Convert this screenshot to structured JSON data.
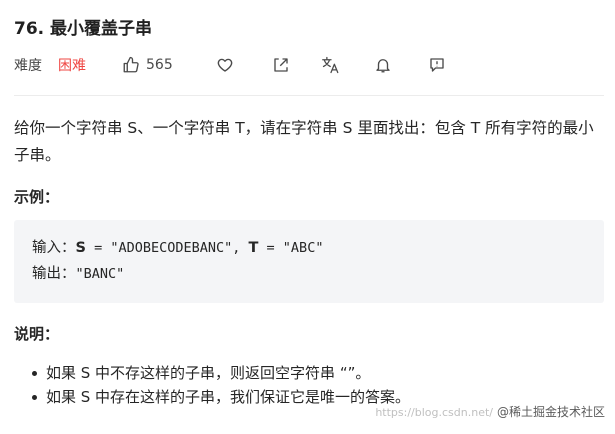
{
  "problem": {
    "title": "76. 最小覆盖子串",
    "difficulty_label": "难度",
    "difficulty_value": "困难",
    "likes": "565"
  },
  "description": "给你一个字符串 S、一个字符串 T，请在字符串 S 里面找出：包含 T 所有字符的最小子串。",
  "example": {
    "heading": "示例：",
    "input_label": "输入：",
    "s_var": "S",
    "s_value": " = \"ADOBECODEBANC\", ",
    "t_var": "T",
    "t_value": " = \"ABC\"",
    "output_label": "输出：",
    "output_value": "\"BANC\""
  },
  "notes": {
    "heading": "说明：",
    "items": [
      "如果 S 中不存这样的子串，则返回空字符串 “”。",
      "如果 S 中存在这样的子串，我们保证它是唯一的答案。"
    ]
  },
  "watermark": {
    "url": "https://blog.csdn.net/",
    "site": "@稀土掘金技术社区"
  },
  "icons": [
    "thumbs-up-icon",
    "heart-icon",
    "share-icon",
    "translate-icon",
    "bell-icon",
    "feedback-icon"
  ]
}
